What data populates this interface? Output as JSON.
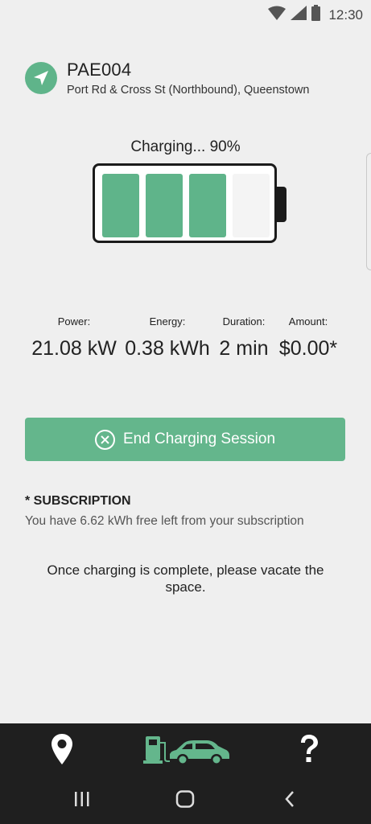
{
  "status_bar": {
    "time": "12:30",
    "icons": [
      "wifi-icon",
      "signal-icon",
      "battery-icon"
    ]
  },
  "station": {
    "code": "PAE004",
    "address": "Port Rd & Cross St (Northbound), Queenstown",
    "icon": "navigation-arrow-icon"
  },
  "charging": {
    "label": "Charging... 90%",
    "cells_filled": 3,
    "cells_total": 4
  },
  "metrics": [
    {
      "label": "Power:",
      "value": "21.08 kW"
    },
    {
      "label": "Energy:",
      "value": "0.38 kWh"
    },
    {
      "label": "Duration:",
      "value": "2 min"
    },
    {
      "label": "Amount:",
      "value": "$0.00*"
    }
  ],
  "end_button": {
    "label": "End Charging Session",
    "icon": "close-circle-icon"
  },
  "subscription": {
    "title": "* SUBSCRIPTION",
    "text": "You have 6.62 kWh free left from your subscription"
  },
  "notice": "Once charging is complete, please vacate the space.",
  "bottom_nav": {
    "items": [
      "location-pin-icon",
      "charging-car-icon",
      "help-icon"
    ]
  },
  "system_nav": {
    "items": [
      "recent-apps-icon",
      "home-icon",
      "back-icon"
    ]
  },
  "colors": {
    "accent": "#64b68c",
    "nav_bg": "#1f1f1f",
    "background": "#efefef"
  }
}
